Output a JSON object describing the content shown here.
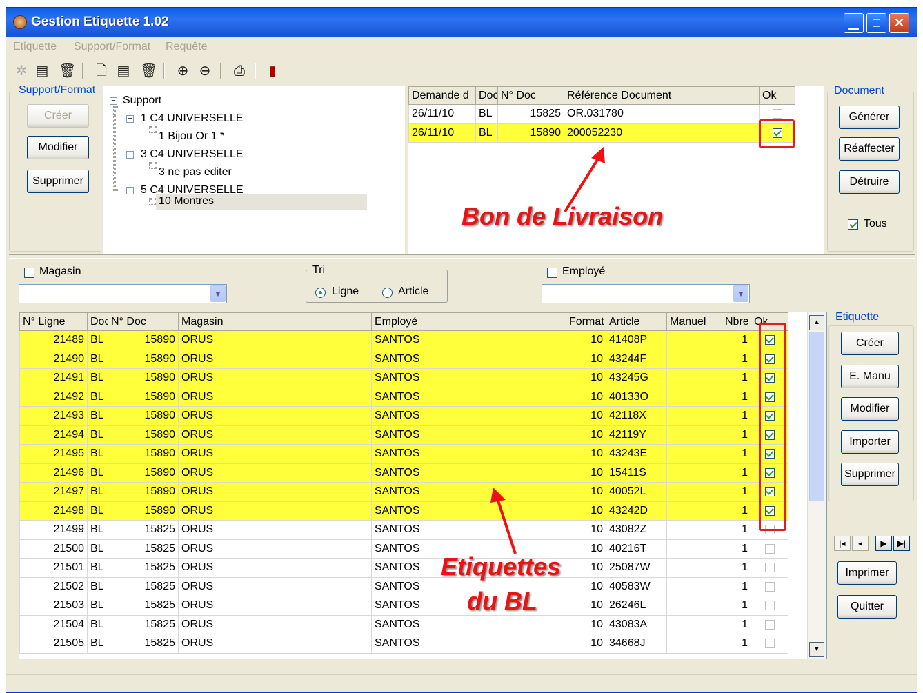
{
  "window": {
    "title": "Gestion Etiquette 1.02"
  },
  "menu": [
    "Etiquette",
    "Support/Format",
    "Requête"
  ],
  "support_format": {
    "title": "Support/Format",
    "buttons": {
      "create": "Créer",
      "modify": "Modifier",
      "delete": "Supprimer"
    }
  },
  "tree": {
    "root": "Support",
    "nodes": [
      {
        "label": "1 C4 UNIVERSELLE",
        "child": "1 Bijou Or 1 *"
      },
      {
        "label": "3 C4 UNIVERSELLE",
        "child": "3 ne pas editer"
      },
      {
        "label": "5 C4 UNIVERSELLE",
        "child": "10 Montres"
      }
    ]
  },
  "documents_grid": {
    "headers": [
      "Demande d",
      "Doc",
      "N° Doc",
      "Référence Document",
      "Ok"
    ],
    "rows": [
      {
        "date": "26/11/10",
        "doc": "BL",
        "num": "15825",
        "ref": "OR.031780",
        "ok": false
      },
      {
        "date": "26/11/10",
        "doc": "BL",
        "num": "15890",
        "ref": "200052230",
        "ok": true
      }
    ]
  },
  "document_panel": {
    "title": "Document",
    "buttons": {
      "generate": "Générer",
      "reassign": "Réaffecter",
      "destroy": "Détruire"
    },
    "all_label": "Tous",
    "all_checked": true
  },
  "filters": {
    "magasin_label": "Magasin",
    "tri_title": "Tri",
    "tri_options": [
      "Ligne",
      "Article"
    ],
    "tri_selected": "Ligne",
    "employe_label": "Employé"
  },
  "labels_grid": {
    "headers": [
      "N° Ligne",
      "Doc",
      "N° Doc",
      "Magasin",
      "Employé",
      "Format",
      "Article",
      "Manuel",
      "Nbre",
      "Ok"
    ],
    "rows": [
      {
        "ligne": "21489",
        "doc": "BL",
        "num": "15890",
        "magasin": "ORUS",
        "employe": "SANTOS",
        "format": "10",
        "article": "41408P",
        "manuel": "",
        "nbre": "1",
        "ok": true
      },
      {
        "ligne": "21490",
        "doc": "BL",
        "num": "15890",
        "magasin": "ORUS",
        "employe": "SANTOS",
        "format": "10",
        "article": "43244F",
        "manuel": "",
        "nbre": "1",
        "ok": true
      },
      {
        "ligne": "21491",
        "doc": "BL",
        "num": "15890",
        "magasin": "ORUS",
        "employe": "SANTOS",
        "format": "10",
        "article": "43245G",
        "manuel": "",
        "nbre": "1",
        "ok": true
      },
      {
        "ligne": "21492",
        "doc": "BL",
        "num": "15890",
        "magasin": "ORUS",
        "employe": "SANTOS",
        "format": "10",
        "article": "40133O",
        "manuel": "",
        "nbre": "1",
        "ok": true
      },
      {
        "ligne": "21493",
        "doc": "BL",
        "num": "15890",
        "magasin": "ORUS",
        "employe": "SANTOS",
        "format": "10",
        "article": "42118X",
        "manuel": "",
        "nbre": "1",
        "ok": true
      },
      {
        "ligne": "21494",
        "doc": "BL",
        "num": "15890",
        "magasin": "ORUS",
        "employe": "SANTOS",
        "format": "10",
        "article": "42119Y",
        "manuel": "",
        "nbre": "1",
        "ok": true
      },
      {
        "ligne": "21495",
        "doc": "BL",
        "num": "15890",
        "magasin": "ORUS",
        "employe": "SANTOS",
        "format": "10",
        "article": "43243E",
        "manuel": "",
        "nbre": "1",
        "ok": true
      },
      {
        "ligne": "21496",
        "doc": "BL",
        "num": "15890",
        "magasin": "ORUS",
        "employe": "SANTOS",
        "format": "10",
        "article": "15411S",
        "manuel": "",
        "nbre": "1",
        "ok": true
      },
      {
        "ligne": "21497",
        "doc": "BL",
        "num": "15890",
        "magasin": "ORUS",
        "employe": "SANTOS",
        "format": "10",
        "article": "40052L",
        "manuel": "",
        "nbre": "1",
        "ok": true
      },
      {
        "ligne": "21498",
        "doc": "BL",
        "num": "15890",
        "magasin": "ORUS",
        "employe": "SANTOS",
        "format": "10",
        "article": "43242D",
        "manuel": "",
        "nbre": "1",
        "ok": true
      },
      {
        "ligne": "21499",
        "doc": "BL",
        "num": "15825",
        "magasin": "ORUS",
        "employe": "SANTOS",
        "format": "10",
        "article": "43082Z",
        "manuel": "",
        "nbre": "1",
        "ok": false
      },
      {
        "ligne": "21500",
        "doc": "BL",
        "num": "15825",
        "magasin": "ORUS",
        "employe": "SANTOS",
        "format": "10",
        "article": "40216T",
        "manuel": "",
        "nbre": "1",
        "ok": false
      },
      {
        "ligne": "21501",
        "doc": "BL",
        "num": "15825",
        "magasin": "ORUS",
        "employe": "SANTOS",
        "format": "10",
        "article": "25087W",
        "manuel": "",
        "nbre": "1",
        "ok": false
      },
      {
        "ligne": "21502",
        "doc": "BL",
        "num": "15825",
        "magasin": "ORUS",
        "employe": "SANTOS",
        "format": "10",
        "article": "40583W",
        "manuel": "",
        "nbre": "1",
        "ok": false
      },
      {
        "ligne": "21503",
        "doc": "BL",
        "num": "15825",
        "magasin": "ORUS",
        "employe": "SANTOS",
        "format": "10",
        "article": "26246L",
        "manuel": "",
        "nbre": "1",
        "ok": false
      },
      {
        "ligne": "21504",
        "doc": "BL",
        "num": "15825",
        "magasin": "ORUS",
        "employe": "SANTOS",
        "format": "10",
        "article": "43083A",
        "manuel": "",
        "nbre": "1",
        "ok": false
      },
      {
        "ligne": "21505",
        "doc": "BL",
        "num": "15825",
        "magasin": "ORUS",
        "employe": "SANTOS",
        "format": "10",
        "article": "34668J",
        "manuel": "",
        "nbre": "1",
        "ok": false
      }
    ]
  },
  "etiquette_panel": {
    "title": "Etiquette",
    "buttons": {
      "create": "Créer",
      "manual": "E. Manu",
      "modify": "Modifier",
      "import": "Importer",
      "delete": "Supprimer"
    },
    "print": "Imprimer",
    "quit": "Quitter"
  },
  "annotations": {
    "bon": "Bon de Livraison",
    "etiquettes_line1": "Etiquettes",
    "etiquettes_line2": "du BL"
  },
  "colors": {
    "highlight": "#ffff3c",
    "annotation": "#ef1111",
    "title_bar": "#0a5fe8"
  }
}
